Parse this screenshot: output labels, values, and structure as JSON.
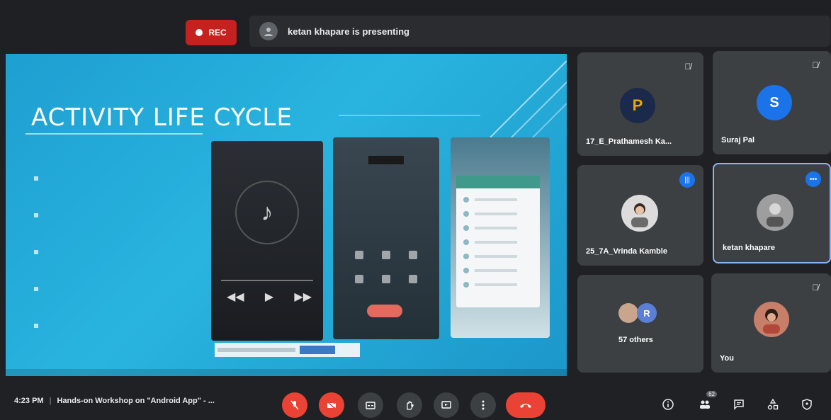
{
  "header": {
    "rec_label": "REC",
    "presenting_text": "ketan khapare is presenting"
  },
  "slide": {
    "title": "ACTIVITY LIFE CYCLE"
  },
  "participants": [
    {
      "name": "17_E_Prathamesh Ka...",
      "initial": "P",
      "avatar_color": "#1b2a4a"
    },
    {
      "name": "Suraj Pal",
      "initial": "S",
      "avatar_color": "#1a73e8"
    },
    {
      "name": "25_7A_Vrinda Kamble",
      "initial": "",
      "avatar_color": "#dcdcdc"
    },
    {
      "name": "ketan khapare",
      "initial": "",
      "avatar_color": "#9e9e9e"
    },
    {
      "name": "57 others",
      "initial": "R",
      "avatar_color": "#5b7fd6"
    },
    {
      "name": "You",
      "initial": "",
      "avatar_color": "#c77f6a"
    }
  ],
  "footer": {
    "time": "4:23 PM",
    "meeting_title": "Hands-on Workshop on \"Android App\" - ...",
    "people_count": "62"
  },
  "colors": {
    "accent_red": "#ea4335",
    "accent_blue": "#1a73e8",
    "slide_bg": "#29b4df"
  }
}
